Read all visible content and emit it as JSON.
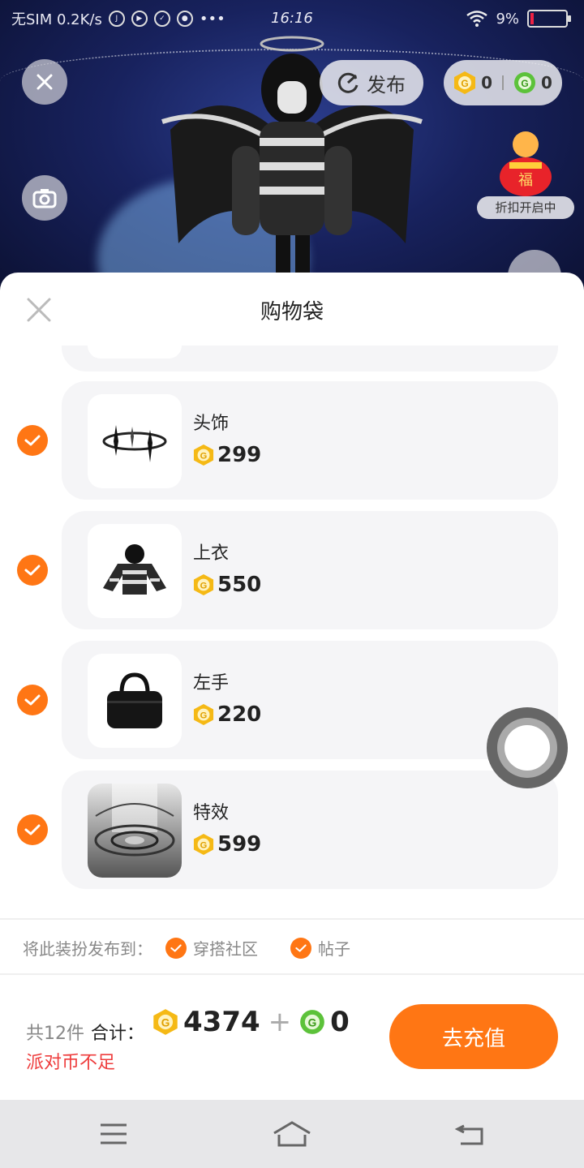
{
  "status_bar": {
    "carrier": "无SIM 0.2K/s",
    "time": "16:16",
    "battery": "9%"
  },
  "scene": {
    "publish_label": "发布",
    "gold_coins": "0",
    "green_coins": "0",
    "discount_label": "折扣开启中"
  },
  "sheet": {
    "title": "购物袋",
    "items": [
      {
        "name": "头饰",
        "price": "299",
        "checked": true
      },
      {
        "name": "上衣",
        "price": "550",
        "checked": true
      },
      {
        "name": "左手",
        "price": "220",
        "checked": true
      },
      {
        "name": "特效",
        "price": "599",
        "checked": true
      }
    ],
    "publish_to_label": "将此装扮发布到：",
    "publish_options": [
      {
        "label": "穿搭社区",
        "checked": true
      },
      {
        "label": "帖子",
        "checked": true
      }
    ],
    "count_text": "共12件",
    "total_label": "合计：",
    "total_gold": "4374",
    "plus": "+",
    "total_green": "0",
    "warning": "派对币不足",
    "recharge_label": "去充值"
  },
  "colors": {
    "accent": "#ff7614",
    "warning": "#ee3c3c",
    "coin_gold": "#f5b915",
    "coin_green": "#5cc23a"
  },
  "icons": {
    "close": "close-icon",
    "camera": "camera-icon",
    "publish": "refresh-publish-icon",
    "coin_gold": "gold-coin-icon",
    "coin_green": "green-coin-icon",
    "check": "check-icon",
    "nav_menu": "menu-icon",
    "nav_home": "home-icon",
    "nav_back": "back-icon"
  }
}
